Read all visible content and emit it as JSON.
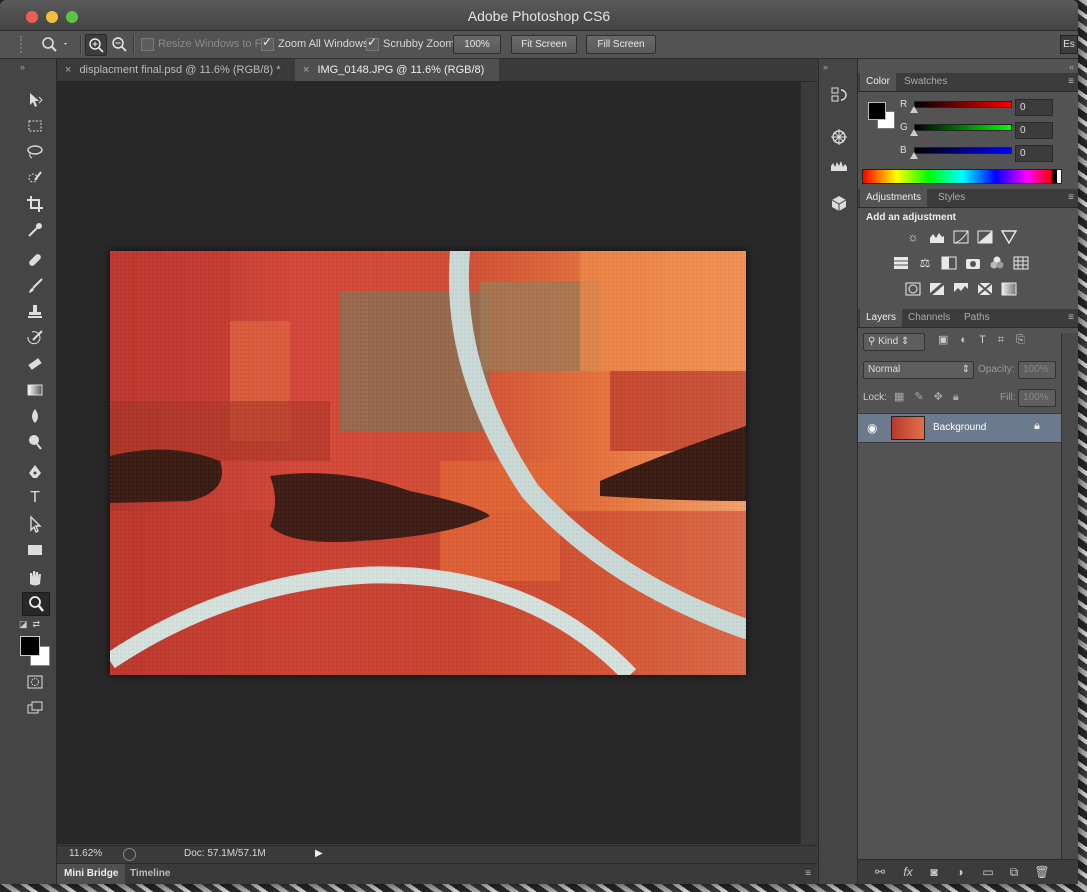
{
  "app": {
    "title": "Adobe Photoshop CS6"
  },
  "options_bar": {
    "resize_windows": "Resize Windows to Fit",
    "zoom_all": "Zoom All Windows",
    "scrubby": "Scrubby Zoom",
    "btn_100": "100%",
    "btn_fit": "Fit Screen",
    "btn_fill": "Fill Screen",
    "workspace": "Es"
  },
  "tabs": [
    {
      "label": "displacment final.psd @ 11.6% (RGB/8) *"
    },
    {
      "label": "IMG_0148.JPG @ 11.6% (RGB/8)"
    }
  ],
  "status": {
    "zoom": "11.62%",
    "doc": "Doc: 57.1M/57.1M"
  },
  "bottom_tabs": [
    "Mini Bridge",
    "Timeline"
  ],
  "color_panel": {
    "tabs": [
      "Color",
      "Swatches"
    ],
    "r_label": "R",
    "g_label": "G",
    "b_label": "B",
    "r": "0",
    "g": "0",
    "b": "0"
  },
  "adjustments_panel": {
    "tabs": [
      "Adjustments",
      "Styles"
    ],
    "heading": "Add an adjustment"
  },
  "layers_panel": {
    "tabs": [
      "Layers",
      "Channels",
      "Paths"
    ],
    "kind": "Kind",
    "blend_mode": "Normal",
    "opacity_label": "Opacity:",
    "opacity": "100%",
    "lock_label": "Lock:",
    "fill_label": "Fill:",
    "fill": "100%",
    "layer_name": "Background"
  },
  "colors": {
    "image_red": "#c4402e",
    "image_orange": "#f0905a",
    "layer_selected": "#6c7a8e"
  }
}
